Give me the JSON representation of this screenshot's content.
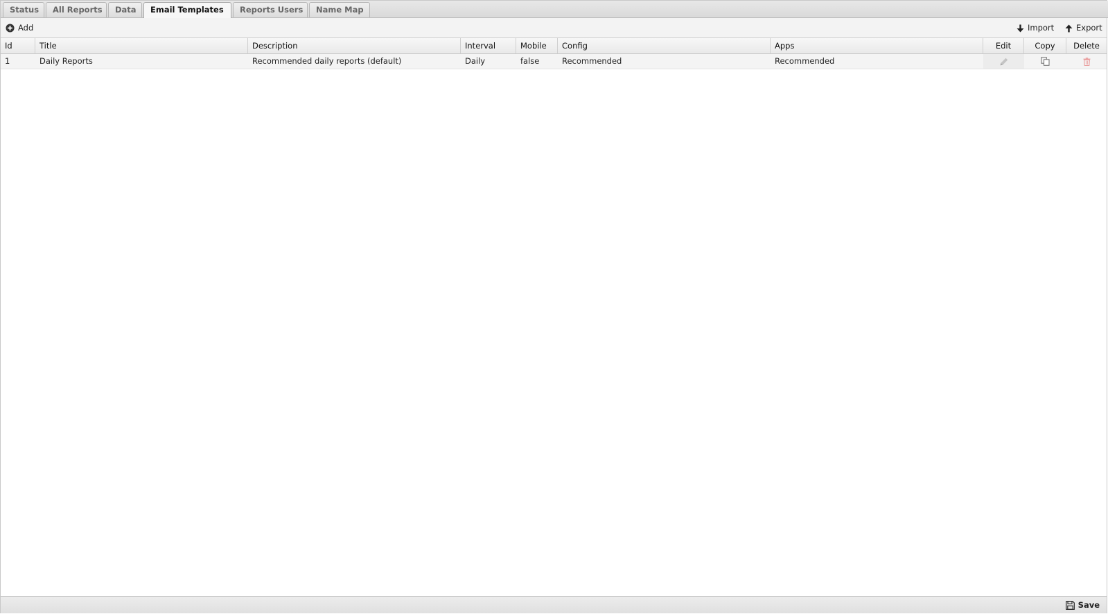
{
  "tabs": [
    {
      "label": "Status",
      "active": false
    },
    {
      "label": "All Reports",
      "active": false
    },
    {
      "label": "Data",
      "active": false
    },
    {
      "label": "Email Templates",
      "active": true
    },
    {
      "label": "Reports Users",
      "active": false
    },
    {
      "label": "Name Map",
      "active": false
    }
  ],
  "toolbar": {
    "add_label": "Add",
    "import_label": "Import",
    "export_label": "Export"
  },
  "table": {
    "columns": {
      "id": "Id",
      "title": "Title",
      "description": "Description",
      "interval": "Interval",
      "mobile": "Mobile",
      "config": "Config",
      "apps": "Apps",
      "edit": "Edit",
      "copy": "Copy",
      "delete": "Delete"
    },
    "rows": [
      {
        "id": "1",
        "title": "Daily Reports",
        "description": "Recommended daily reports (default)",
        "interval": "Daily",
        "mobile": "false",
        "config": "Recommended",
        "apps": "Recommended"
      }
    ]
  },
  "footer": {
    "save_label": "Save"
  },
  "icons": {
    "add": "plus-circle-icon",
    "import": "arrow-down-icon",
    "export": "arrow-up-icon",
    "edit": "pencil-icon",
    "copy": "copy-icon",
    "delete": "trash-icon",
    "save": "floppy-disk-icon"
  },
  "colors": {
    "delete_icon": "#e8a3a3",
    "edit_icon": "#b8b8b8",
    "copy_icon": "#777777"
  }
}
